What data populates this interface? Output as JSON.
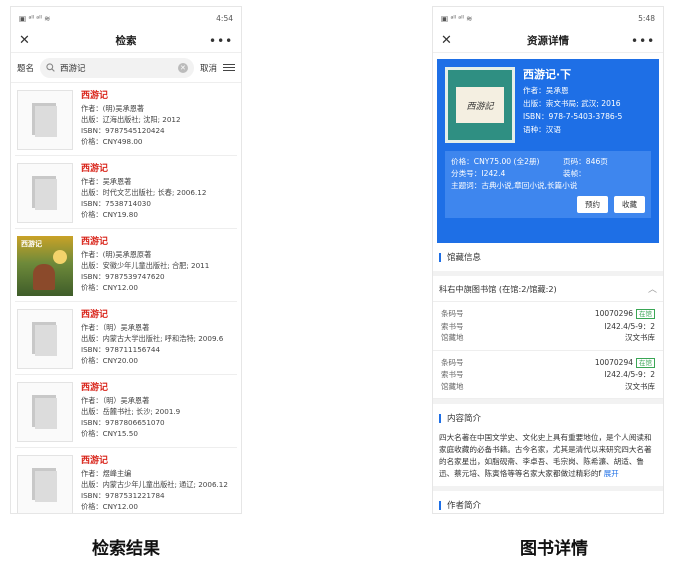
{
  "left": {
    "status": {
      "left": "Ⓜ ᴬᴺᴸ ²ᵉⁱ ѱ 1.3 K/s",
      "time": "4:54"
    },
    "nav": {
      "title": "检索"
    },
    "search": {
      "field": "题名",
      "query": "西游记",
      "cancel": "取消"
    },
    "results": [
      {
        "title": "西游记",
        "author": "作者：(明)吴承恩著",
        "publisher": "出版：辽海出版社; 沈阳; 2012",
        "isbn": "ISBN：9787545120424",
        "price": "价格：CNY498.00"
      },
      {
        "title": "西游记",
        "author": "作者：吴承恩著",
        "publisher": "出版：时代文艺出版社; 长春; 2006.12",
        "isbn": "ISBN：7538714030",
        "price": "价格：CNY19.80"
      },
      {
        "title": "西游记",
        "author": "作者：(明)吴承恩原著",
        "publisher": "出版：安徽少年儿童出版社; 合肥; 2011",
        "isbn": "ISBN：9787539747620",
        "price": "价格：CNY12.00",
        "cover_photo": true,
        "cover_text": "西游记"
      },
      {
        "title": "西游记",
        "author": "作者：（明）吴承恩著",
        "publisher": "出版：内蒙古大学出版社; 呼和浩特; 2009.6",
        "isbn": "ISBN：978711156744",
        "price": "价格：CNY20.00"
      },
      {
        "title": "西游记",
        "author": "作者：（明）吴承恩著",
        "publisher": "出版：岳麓书社; 长沙; 2001.9",
        "isbn": "ISBN：9787806651070",
        "price": "价格：CNY15.50"
      },
      {
        "title": "西游记",
        "author": "作者：煜峰主编",
        "publisher": "出版：内蒙古少年儿童出版社; 通辽; 2006.12",
        "isbn": "ISBN：9787531221784",
        "price": "价格：CNY12.00"
      }
    ],
    "caption": "检索结果"
  },
  "right": {
    "status": {
      "time": "5:48"
    },
    "nav": {
      "title": "资源详情"
    },
    "detail": {
      "cover_text": "西游記",
      "title": "西游记·下",
      "author": "作者：吴承恩",
      "publisher": "出版：崇文书局; 武汉; 2016",
      "isbn": "ISBN：978-7-5403-3786-5",
      "language": "语种：汉语",
      "price": "价格：CNY75.00 (全2册)",
      "pages": "页码：846页",
      "class": "分类号：I242.4",
      "binding": "装帧：",
      "subject": "主题词：古典小说,章回小说,长篇小说",
      "reserve": "预约",
      "collect": "收藏"
    },
    "holdings_title": "馆藏信息",
    "library": "科右中旗图书馆 (在馆:2/馆藏:2)",
    "holdings": [
      {
        "barcode_label": "条码号",
        "barcode": "10070296",
        "status": "在馆",
        "call_label": "索书号",
        "call": "I242.4/5-9：2",
        "loc_label": "馆藏地",
        "loc": "汉文书库"
      },
      {
        "barcode_label": "条码号",
        "barcode": "10070294",
        "status": "在馆",
        "call_label": "索书号",
        "call": "I242.4/5-9：2",
        "loc_label": "馆藏地",
        "loc": "汉文书库"
      }
    ],
    "intro_title": "内容简介",
    "intro_text": "四大名著在中国文学史、文化史上具有重要地位，是个人阅读和家庭收藏的必备书籍。古今名家，尤其是清代以来研究四大名著的名家星出，如脂砚斋、李卓吾、毛宗岗、陈希濂、胡适、鲁迅、蔡元培、陈寅恪等等名家大家都做过精彩的f",
    "intro_more": "展开",
    "author_title": "作者简介",
    "caption": "图书详情"
  }
}
